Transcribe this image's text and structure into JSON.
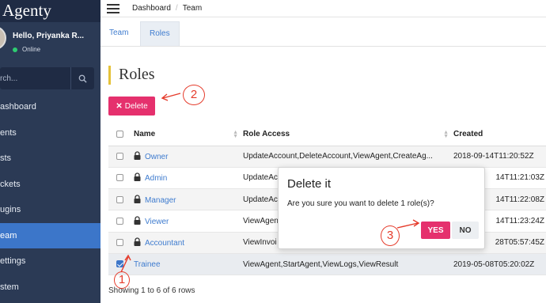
{
  "app": {
    "brand": "Agenty"
  },
  "sidebar": {
    "greeting": "Hello, Priyanka R...",
    "status": "Online",
    "search_placeholder": "rch...",
    "items": [
      {
        "label": "ashboard"
      },
      {
        "label": "ents"
      },
      {
        "label": "sts"
      },
      {
        "label": "ckets"
      },
      {
        "label": "ugins"
      },
      {
        "label": "eam"
      },
      {
        "label": "ettings"
      },
      {
        "label": "stem"
      }
    ]
  },
  "breadcrumb": {
    "first": "Dashboard",
    "second": "Team"
  },
  "tabs": [
    {
      "label": "Team"
    },
    {
      "label": "Roles"
    }
  ],
  "page": {
    "title": "Roles",
    "delete_label": "Delete"
  },
  "table": {
    "headers": {
      "name": "Name",
      "access": "Role Access",
      "created": "Created"
    },
    "rows": [
      {
        "name": "Owner",
        "access": "UpdateAccount,DeleteAccount,ViewAgent,CreateAg...",
        "created": "2018-09-14T11:20:52Z"
      },
      {
        "name": "Admin",
        "access": "UpdateAc",
        "created": "14T11:21:03Z"
      },
      {
        "name": "Manager",
        "access": "UpdateAc",
        "created": "14T11:22:08Z"
      },
      {
        "name": "Viewer",
        "access": "ViewAgen",
        "created": "14T11:23:24Z"
      },
      {
        "name": "Accountant",
        "access": "ViewInvoi",
        "created": "28T05:57:45Z"
      },
      {
        "name": "Trainee",
        "access": "ViewAgent,StartAgent,ViewLogs,ViewResult",
        "created": "2019-05-08T05:20:02Z"
      }
    ]
  },
  "footer": {
    "text": "Showing 1 to 6 of 6 rows"
  },
  "dialog": {
    "title": "Delete it",
    "message": "Are you sure you want to delete 1 role(s)?",
    "yes_label": "YES",
    "no_label": "NO"
  },
  "annotations": {
    "one": "1",
    "two": "2",
    "three": "3"
  },
  "colors": {
    "sidebar": "#2b3a55",
    "accent": "#3c76c9",
    "danger": "#e5306d",
    "annotation": "#e53b2b",
    "title_bar": "#e5c239"
  }
}
